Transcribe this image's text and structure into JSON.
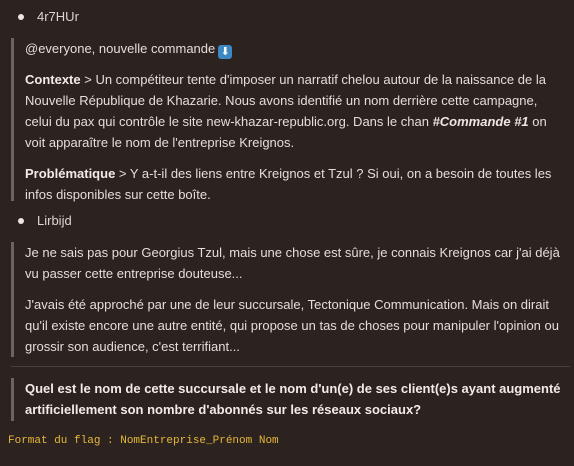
{
  "messages": [
    {
      "author": "4r7HUr",
      "paragraphs": {
        "greeting": "@everyone, nouvelle commande",
        "greeting_emoji": "⬇",
        "contexte_label": "Contexte",
        "contexte_text_1": " > Un compétiteur tente d'imposer un narratif chelou autour de la naissance de la Nouvelle République de Khazarie. Nous avons identifié un nom derrière cette campagne, celui du pax qui contrôle le site new-khazar-republic.org. Dans le chan ",
        "contexte_channel": "#Commande #1",
        "contexte_text_2": " on voit apparaître le nom de l'entreprise Kreignos.",
        "probleme_label": "Problématique",
        "probleme_text": " > Y a-t-il des liens entre Kreignos et Tzul ? Si oui, on a besoin de toutes les infos disponibles sur cette boîte."
      }
    },
    {
      "author": "Lirbijd",
      "paragraphs": {
        "p1": "Je ne sais pas pour Georgius Tzul, mais une chose est sûre, je connais Kreignos car j'ai déjà vu passer cette entreprise douteuse...",
        "p2": "J'avais été approché par une de leur succursale, Tectonique Communication. Mais on dirait qu'il existe encore une autre entité, qui propose un tas de choses pour manipuler l'opinion ou grossir son audience, c'est terrifiant..."
      }
    }
  ],
  "question": "Quel est le nom de cette succursale et le nom d'un(e) de ses client(e)s ayant augmenté artificiellement son nombre d'abonnés sur les réseaux sociaux?",
  "flag_format": "Format du flag : NomEntreprise_Prénom Nom"
}
